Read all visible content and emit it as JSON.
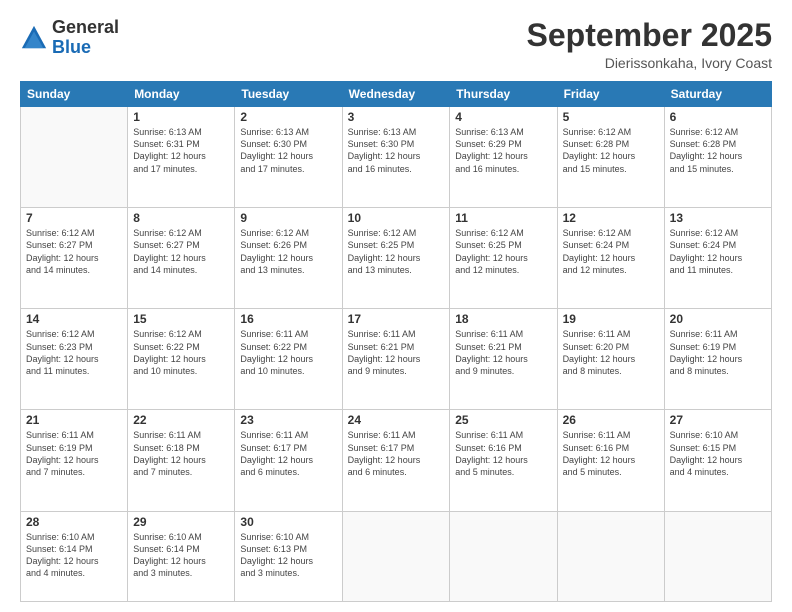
{
  "logo": {
    "general": "General",
    "blue": "Blue"
  },
  "header": {
    "month": "September 2025",
    "location": "Dierissonkaha, Ivory Coast"
  },
  "weekdays": [
    "Sunday",
    "Monday",
    "Tuesday",
    "Wednesday",
    "Thursday",
    "Friday",
    "Saturday"
  ],
  "weeks": [
    [
      {
        "day": "",
        "info": ""
      },
      {
        "day": "1",
        "info": "Sunrise: 6:13 AM\nSunset: 6:31 PM\nDaylight: 12 hours\nand 17 minutes."
      },
      {
        "day": "2",
        "info": "Sunrise: 6:13 AM\nSunset: 6:30 PM\nDaylight: 12 hours\nand 17 minutes."
      },
      {
        "day": "3",
        "info": "Sunrise: 6:13 AM\nSunset: 6:30 PM\nDaylight: 12 hours\nand 16 minutes."
      },
      {
        "day": "4",
        "info": "Sunrise: 6:13 AM\nSunset: 6:29 PM\nDaylight: 12 hours\nand 16 minutes."
      },
      {
        "day": "5",
        "info": "Sunrise: 6:12 AM\nSunset: 6:28 PM\nDaylight: 12 hours\nand 15 minutes."
      },
      {
        "day": "6",
        "info": "Sunrise: 6:12 AM\nSunset: 6:28 PM\nDaylight: 12 hours\nand 15 minutes."
      }
    ],
    [
      {
        "day": "7",
        "info": "Sunrise: 6:12 AM\nSunset: 6:27 PM\nDaylight: 12 hours\nand 14 minutes."
      },
      {
        "day": "8",
        "info": "Sunrise: 6:12 AM\nSunset: 6:27 PM\nDaylight: 12 hours\nand 14 minutes."
      },
      {
        "day": "9",
        "info": "Sunrise: 6:12 AM\nSunset: 6:26 PM\nDaylight: 12 hours\nand 13 minutes."
      },
      {
        "day": "10",
        "info": "Sunrise: 6:12 AM\nSunset: 6:25 PM\nDaylight: 12 hours\nand 13 minutes."
      },
      {
        "day": "11",
        "info": "Sunrise: 6:12 AM\nSunset: 6:25 PM\nDaylight: 12 hours\nand 12 minutes."
      },
      {
        "day": "12",
        "info": "Sunrise: 6:12 AM\nSunset: 6:24 PM\nDaylight: 12 hours\nand 12 minutes."
      },
      {
        "day": "13",
        "info": "Sunrise: 6:12 AM\nSunset: 6:24 PM\nDaylight: 12 hours\nand 11 minutes."
      }
    ],
    [
      {
        "day": "14",
        "info": "Sunrise: 6:12 AM\nSunset: 6:23 PM\nDaylight: 12 hours\nand 11 minutes."
      },
      {
        "day": "15",
        "info": "Sunrise: 6:12 AM\nSunset: 6:22 PM\nDaylight: 12 hours\nand 10 minutes."
      },
      {
        "day": "16",
        "info": "Sunrise: 6:11 AM\nSunset: 6:22 PM\nDaylight: 12 hours\nand 10 minutes."
      },
      {
        "day": "17",
        "info": "Sunrise: 6:11 AM\nSunset: 6:21 PM\nDaylight: 12 hours\nand 9 minutes."
      },
      {
        "day": "18",
        "info": "Sunrise: 6:11 AM\nSunset: 6:21 PM\nDaylight: 12 hours\nand 9 minutes."
      },
      {
        "day": "19",
        "info": "Sunrise: 6:11 AM\nSunset: 6:20 PM\nDaylight: 12 hours\nand 8 minutes."
      },
      {
        "day": "20",
        "info": "Sunrise: 6:11 AM\nSunset: 6:19 PM\nDaylight: 12 hours\nand 8 minutes."
      }
    ],
    [
      {
        "day": "21",
        "info": "Sunrise: 6:11 AM\nSunset: 6:19 PM\nDaylight: 12 hours\nand 7 minutes."
      },
      {
        "day": "22",
        "info": "Sunrise: 6:11 AM\nSunset: 6:18 PM\nDaylight: 12 hours\nand 7 minutes."
      },
      {
        "day": "23",
        "info": "Sunrise: 6:11 AM\nSunset: 6:17 PM\nDaylight: 12 hours\nand 6 minutes."
      },
      {
        "day": "24",
        "info": "Sunrise: 6:11 AM\nSunset: 6:17 PM\nDaylight: 12 hours\nand 6 minutes."
      },
      {
        "day": "25",
        "info": "Sunrise: 6:11 AM\nSunset: 6:16 PM\nDaylight: 12 hours\nand 5 minutes."
      },
      {
        "day": "26",
        "info": "Sunrise: 6:11 AM\nSunset: 6:16 PM\nDaylight: 12 hours\nand 5 minutes."
      },
      {
        "day": "27",
        "info": "Sunrise: 6:10 AM\nSunset: 6:15 PM\nDaylight: 12 hours\nand 4 minutes."
      }
    ],
    [
      {
        "day": "28",
        "info": "Sunrise: 6:10 AM\nSunset: 6:14 PM\nDaylight: 12 hours\nand 4 minutes."
      },
      {
        "day": "29",
        "info": "Sunrise: 6:10 AM\nSunset: 6:14 PM\nDaylight: 12 hours\nand 3 minutes."
      },
      {
        "day": "30",
        "info": "Sunrise: 6:10 AM\nSunset: 6:13 PM\nDaylight: 12 hours\nand 3 minutes."
      },
      {
        "day": "",
        "info": ""
      },
      {
        "day": "",
        "info": ""
      },
      {
        "day": "",
        "info": ""
      },
      {
        "day": "",
        "info": ""
      }
    ]
  ]
}
